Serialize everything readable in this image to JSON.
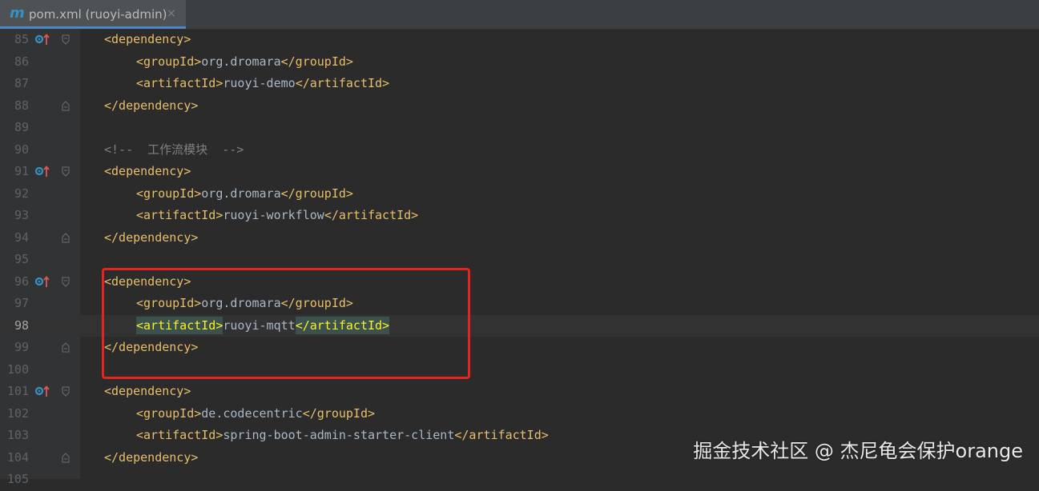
{
  "tab": {
    "icon_letter": "m",
    "title": "pom.xml (ruoyi-admin)",
    "close": "×"
  },
  "lines": [
    {
      "num": "85",
      "indent": 2,
      "icon": true,
      "fold": "open",
      "parts": [
        {
          "t": "tag",
          "v": "<dependency>"
        }
      ]
    },
    {
      "num": "86",
      "indent": 3,
      "parts": [
        {
          "t": "tag",
          "v": "<groupId>"
        },
        {
          "t": "txt",
          "v": "org.dromara"
        },
        {
          "t": "tag",
          "v": "</groupId>"
        }
      ]
    },
    {
      "num": "87",
      "indent": 3,
      "parts": [
        {
          "t": "tag",
          "v": "<artifactId>"
        },
        {
          "t": "txt",
          "v": "ruoyi-demo"
        },
        {
          "t": "tag",
          "v": "</artifactId>"
        }
      ]
    },
    {
      "num": "88",
      "indent": 2,
      "fold": "close",
      "parts": [
        {
          "t": "tag",
          "v": "</dependency>"
        }
      ]
    },
    {
      "num": "89",
      "indent": 0,
      "parts": []
    },
    {
      "num": "90",
      "indent": 2,
      "parts": [
        {
          "t": "cmt",
          "v": "<!--  工作流模块  -->"
        }
      ]
    },
    {
      "num": "91",
      "indent": 2,
      "icon": true,
      "fold": "open",
      "parts": [
        {
          "t": "tag",
          "v": "<dependency>"
        }
      ]
    },
    {
      "num": "92",
      "indent": 3,
      "parts": [
        {
          "t": "tag",
          "v": "<groupId>"
        },
        {
          "t": "txt",
          "v": "org.dromara"
        },
        {
          "t": "tag",
          "v": "</groupId>"
        }
      ]
    },
    {
      "num": "93",
      "indent": 3,
      "parts": [
        {
          "t": "tag",
          "v": "<artifactId>"
        },
        {
          "t": "txt",
          "v": "ruoyi-workflow"
        },
        {
          "t": "tag",
          "v": "</artifactId>"
        }
      ]
    },
    {
      "num": "94",
      "indent": 2,
      "fold": "close",
      "parts": [
        {
          "t": "tag",
          "v": "</dependency>"
        }
      ]
    },
    {
      "num": "95",
      "indent": 0,
      "parts": []
    },
    {
      "num": "96",
      "indent": 2,
      "icon": true,
      "fold": "open",
      "parts": [
        {
          "t": "tag",
          "v": "<dependency>"
        }
      ]
    },
    {
      "num": "97",
      "indent": 3,
      "parts": [
        {
          "t": "tag",
          "v": "<groupId>"
        },
        {
          "t": "txt",
          "v": "org.dromara"
        },
        {
          "t": "tag",
          "v": "</groupId>"
        }
      ]
    },
    {
      "num": "98",
      "indent": 3,
      "current": true,
      "parts": [
        {
          "t": "taghl",
          "v": "<artifactId>"
        },
        {
          "t": "txt",
          "v": "ruoyi-mqtt"
        },
        {
          "t": "taghl",
          "v": "</artifactId>"
        }
      ]
    },
    {
      "num": "99",
      "indent": 2,
      "fold": "close",
      "parts": [
        {
          "t": "tag",
          "v": "</dependency>"
        }
      ]
    },
    {
      "num": "100",
      "indent": 0,
      "parts": []
    },
    {
      "num": "101",
      "indent": 2,
      "icon": true,
      "fold": "open",
      "parts": [
        {
          "t": "tag",
          "v": "<dependency>"
        }
      ]
    },
    {
      "num": "102",
      "indent": 3,
      "parts": [
        {
          "t": "tag",
          "v": "<groupId>"
        },
        {
          "t": "txt",
          "v": "de.codecentric"
        },
        {
          "t": "tag",
          "v": "</groupId>"
        }
      ]
    },
    {
      "num": "103",
      "indent": 3,
      "parts": [
        {
          "t": "tag",
          "v": "<artifactId>"
        },
        {
          "t": "txt",
          "v": "spring-boot-admin-starter-client"
        },
        {
          "t": "tag",
          "v": "</artifactId>"
        }
      ]
    },
    {
      "num": "104",
      "indent": 2,
      "fold": "close",
      "parts": [
        {
          "t": "tag",
          "v": "</dependency>"
        }
      ]
    },
    {
      "num": "105",
      "indent": 0,
      "parts": []
    }
  ],
  "watermark": "掘金技术社区 @ 杰尼龟会保护orange",
  "colors": {
    "tag": "#e8bf6a",
    "text": "#a9b7c6",
    "comment": "#808080",
    "highlight_box": "#e8231f"
  },
  "icons": {
    "gutter": "maven-override-icon",
    "fold_open": "fold-open-icon",
    "fold_close": "fold-close-icon"
  }
}
